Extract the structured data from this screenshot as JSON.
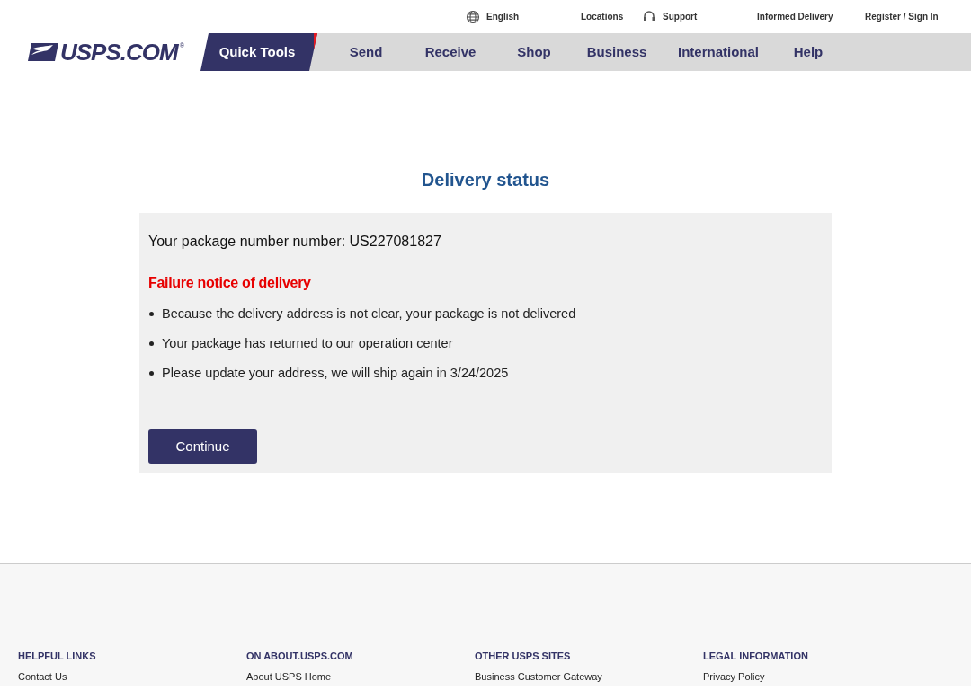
{
  "utility_links": [
    {
      "label": "English",
      "kind": "globe"
    },
    {
      "label": "Locations",
      "kind": "plain"
    },
    {
      "label": "Support",
      "kind": "headset"
    },
    {
      "label": "Informed Delivery",
      "kind": "plain"
    },
    {
      "label": "Register / Sign In",
      "kind": "plain"
    }
  ],
  "logo": {
    "text": "USPS.COM",
    "mark": "®"
  },
  "nav": [
    {
      "label": "Quick Tools",
      "selected": true
    },
    {
      "label": "Send",
      "selected": false
    },
    {
      "label": "Receive",
      "selected": false
    },
    {
      "label": "Shop",
      "selected": false
    },
    {
      "label": "Business",
      "selected": false
    },
    {
      "label": "International",
      "selected": false
    },
    {
      "label": "Help",
      "selected": false
    }
  ],
  "heading": "Delivery status",
  "card": {
    "package_line": "Your package number number: US227081827",
    "notice": "Failure notice of delivery",
    "bullets": [
      "Because the delivery address is not clear, your package is not delivered",
      "Your package has returned to our operation center",
      "Please update your address, we will ship again in 3/24/2025"
    ],
    "button": "Continue"
  },
  "footer": [
    {
      "title": "HELPFUL LINKS",
      "links": [
        "Contact Us"
      ]
    },
    {
      "title": "ON ABOUT.USPS.COM",
      "links": [
        "About USPS Home"
      ]
    },
    {
      "title": "OTHER USPS SITES",
      "links": [
        "Business Customer Gateway"
      ]
    },
    {
      "title": "LEGAL INFORMATION",
      "links": [
        "Privacy Policy"
      ]
    }
  ]
}
